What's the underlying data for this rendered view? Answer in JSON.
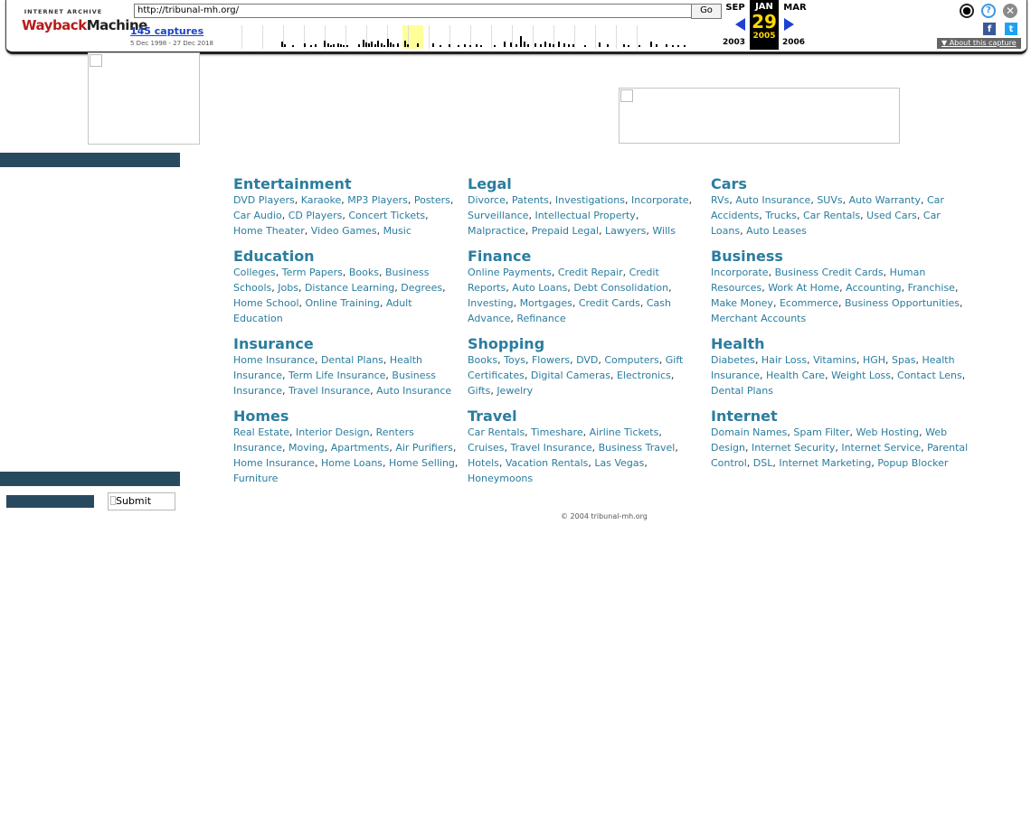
{
  "toolbar": {
    "logo_top": "INTERNET ARCHIVE",
    "logo_main_a": "Wayback",
    "logo_main_b": "Machine",
    "url": "http://tribunal-mh.org/",
    "go_label": "Go",
    "captures_label": "145 captures",
    "date_range": "5 Dec 1998 - 27 Dec 2018",
    "prev_month": "SEP",
    "current_month": "JAN",
    "current_day": "29",
    "current_year": "2005",
    "next_month": "MAR",
    "prev_year": "2003",
    "next_year": "2006",
    "about_label": "About this capture",
    "colors": {
      "accent_blue": "#1f3fd6",
      "highlight": "#ffff99",
      "date_gold": "#ffd700"
    }
  },
  "page": {
    "faint_text": "",
    "submit_label": "Submit",
    "copyright": "© 2004 tribunal-mh.org",
    "colors": {
      "link": "#2a7d9f",
      "sidebar_bar": "#284a5f"
    }
  },
  "categories": [
    {
      "title": "Entertainment",
      "links": [
        "DVD Players",
        "Karaoke",
        "MP3 Players",
        "Posters",
        "Car Audio",
        "CD Players",
        "Concert Tickets",
        "Home Theater",
        "Video Games",
        "Music"
      ]
    },
    {
      "title": "Legal",
      "links": [
        "Divorce",
        "Patents",
        "Investigations",
        "Incorporate",
        "Surveillance",
        "Intellectual Property",
        "Malpractice",
        "Prepaid Legal",
        "Lawyers",
        "Wills"
      ]
    },
    {
      "title": "Cars",
      "links": [
        "RVs",
        "Auto Insurance",
        "SUVs",
        "Auto Warranty",
        "Car Accidents",
        "Trucks",
        "Car Rentals",
        "Used Cars",
        "Car Loans",
        "Auto Leases"
      ]
    },
    {
      "title": "Education",
      "links": [
        "Colleges",
        "Term Papers",
        "Books",
        "Business Schools",
        "Jobs",
        "Distance Learning",
        "Degrees",
        "Home School",
        "Online Training",
        "Adult Education"
      ]
    },
    {
      "title": "Finance",
      "links": [
        "Online Payments",
        "Credit Repair",
        "Credit Reports",
        "Auto Loans",
        "Debt Consolidation",
        "Investing",
        "Mortgages",
        "Credit Cards",
        "Cash Advance",
        "Refinance"
      ]
    },
    {
      "title": "Business",
      "links": [
        "Incorporate",
        "Business Credit Cards",
        "Human Resources",
        "Work At Home",
        "Accounting",
        "Franchise",
        "Make Money",
        "Ecommerce",
        "Business Opportunities",
        "Merchant Accounts"
      ]
    },
    {
      "title": "Insurance",
      "links": [
        "Home Insurance",
        "Dental Plans",
        "Health Insurance",
        "Term Life Insurance",
        "Business Insurance",
        "Travel Insurance",
        "Auto Insurance"
      ]
    },
    {
      "title": "Shopping",
      "links": [
        "Books",
        "Toys",
        "Flowers",
        "DVD",
        "Computers",
        "Gift Certificates",
        "Digital Cameras",
        "Electronics",
        "Gifts",
        "Jewelry"
      ]
    },
    {
      "title": "Health",
      "links": [
        "Diabetes",
        "Hair Loss",
        "Vitamins",
        "HGH",
        "Spas",
        "Health Insurance",
        "Health Care",
        "Weight Loss",
        "Contact Lens",
        "Dental Plans"
      ]
    },
    {
      "title": "Homes",
      "links": [
        "Real Estate",
        "Interior Design",
        "Renters Insurance",
        "Moving",
        "Apartments",
        "Air Purifiers",
        "Home Insurance",
        "Home Loans",
        "Home Selling",
        "Furniture"
      ]
    },
    {
      "title": "Travel",
      "links": [
        "Car Rentals",
        "Timeshare",
        "Airline Tickets",
        "Cruises",
        "Travel Insurance",
        "Business Travel",
        "Hotels",
        "Vacation Rentals",
        "Las Vegas",
        "Honeymoons"
      ]
    },
    {
      "title": "Internet",
      "links": [
        "Domain Names",
        "Spam Filter",
        "Web Hosting",
        "Web Design",
        "Internet Security",
        "Internet Service",
        "Parental Control",
        "DSL",
        "Internet Marketing",
        "Popup Blocker"
      ]
    }
  ]
}
